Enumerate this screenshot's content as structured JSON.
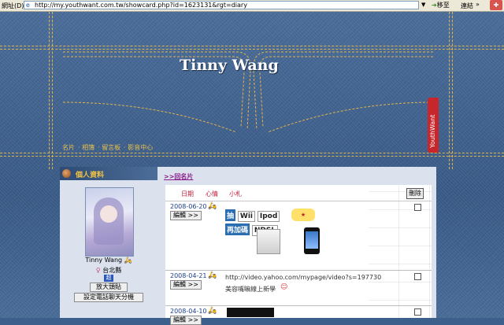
{
  "browser": {
    "address_label": "網址(D)",
    "url": "http://my.youthwant.com.tw/showcard.php?id=1623131&rgt=diary",
    "go_label": "移至",
    "links_label": "連結"
  },
  "site": {
    "title": "Tinny Wang",
    "nav": [
      "名片",
      "相簿",
      "留言板",
      "影音中心"
    ],
    "brand": "YouthWant"
  },
  "profile": {
    "header": "個人資料",
    "name": "Tinny Wang",
    "location": "台北縣",
    "badge": "超品",
    "enlarge_button": "放大頭貼",
    "chat_button": "設定電話聊天分機"
  },
  "diary": {
    "all_link": ">>回名片",
    "columns": [
      "日期",
      "心情",
      "小札"
    ],
    "delete_label": "刪除",
    "edit_label": "編輯 >>",
    "entries": [
      {
        "date": "2008-06-20",
        "ad_lines": [
          "抽",
          "Wii",
          "Ipod",
          "再加碼",
          "NDSL"
        ]
      },
      {
        "date": "2008-04-21",
        "line1": "http://video.yahoo.com/mypage/video?s=197730",
        "line2": "美容嘴嘛線上新學"
      },
      {
        "date": "2008-04-10"
      }
    ]
  },
  "colors": {
    "accent": "#c0243f",
    "stitch": "#e1b44a",
    "brand": "#c7262b"
  }
}
